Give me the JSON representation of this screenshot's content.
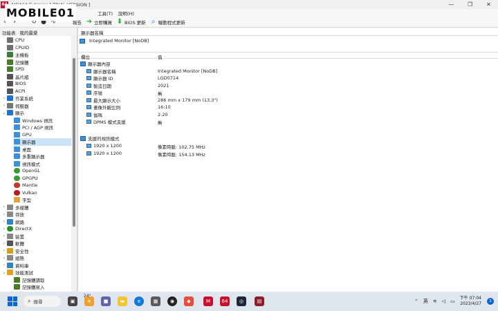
{
  "window": {
    "logo_text": "64",
    "title": "AIDA64 Extreme  [ TRIAL VERSION ]",
    "controls": [
      "—",
      "❐",
      "✕"
    ]
  },
  "watermark": {
    "text": "MOBILE01"
  },
  "menubar": {
    "items": [
      {
        "label": "工具(T)"
      },
      {
        "label": "說明(H)"
      }
    ]
  },
  "toolbar": {
    "report_label": "報告",
    "buy_label": "立即購買",
    "bios_label": "BIOS 更新",
    "driver_label": "驅動程式更新"
  },
  "sidebar": {
    "tabs": [
      "功能表",
      "我的最愛"
    ],
    "tree": [
      {
        "label": "CPU",
        "color": "#707070"
      },
      {
        "label": "CPUID",
        "color": "#707070"
      },
      {
        "label": "主機板",
        "color": "#3a7d3a"
      },
      {
        "label": "記憶體",
        "color": "#4a7a2a"
      },
      {
        "label": "SPD",
        "color": "#4a7a2a"
      },
      {
        "label": "晶片組",
        "color": "#555555"
      },
      {
        "label": "BIOS",
        "color": "#555555"
      },
      {
        "label": "ACPI",
        "color": "#555555"
      },
      {
        "label": "作業系統",
        "color": "#1e73d0"
      },
      {
        "label": "伺服器",
        "color": "#777777"
      },
      {
        "label": "顯示",
        "color": "#1e73d0"
      },
      {
        "label": "Windows 視訊",
        "color": "#3d8fd6"
      },
      {
        "label": "PCI / AGP 視訊",
        "color": "#3d8fd6"
      },
      {
        "label": "GPU",
        "color": "#3d8fd6"
      },
      {
        "label": "顯示器",
        "color": "#3d8fd6"
      },
      {
        "label": "桌面",
        "color": "#3d8fd6"
      },
      {
        "label": "多重顯示器",
        "color": "#3d8fd6"
      },
      {
        "label": "視訊模式",
        "color": "#3d8fd6"
      },
      {
        "label": "OpenGL",
        "color": "#3a9a3a"
      },
      {
        "label": "GPGPU",
        "color": "#3a9a3a"
      },
      {
        "label": "Mantle",
        "color": "#c0392b"
      },
      {
        "label": "Vulkan",
        "color": "#b71c1c"
      },
      {
        "label": "字型",
        "color": "#d9a441"
      },
      {
        "label": "多媒體",
        "color": "#888888"
      },
      {
        "label": "存放",
        "color": "#888888"
      },
      {
        "label": "網路",
        "color": "#2e86c1"
      },
      {
        "label": "DirectX",
        "color": "#2e8b2e"
      },
      {
        "label": "裝置",
        "color": "#888888"
      },
      {
        "label": "軟體",
        "color": "#555555"
      },
      {
        "label": "安全性",
        "color": "#d4a017"
      },
      {
        "label": "組態",
        "color": "#888888"
      },
      {
        "label": "資料庫",
        "color": "#2e86c1"
      },
      {
        "label": "效能測試",
        "color": "#e0a020"
      },
      {
        "label": "記憶體讀取",
        "color": "#4a7a2a"
      },
      {
        "label": "記憶體寫入",
        "color": "#4a7a2a"
      }
    ]
  },
  "content": {
    "header": "顯示器名稱",
    "device": "Integrated Monitor [NoDB]",
    "col_field": "欄位",
    "col_value": "值",
    "section1": "顯示器內容",
    "props": [
      {
        "name": "顯示器名稱",
        "value": "Integrated Monitor [NoDB]"
      },
      {
        "name": "顯示器 ID",
        "value": "LGD0714"
      },
      {
        "name": "製造日期",
        "value": "2021"
      },
      {
        "name": "序號",
        "value": "無"
      },
      {
        "name": "最大顯示大小",
        "value": "286 mm x 179 mm (13.3\")"
      },
      {
        "name": "畫像外觀比例",
        "value": "16:10"
      },
      {
        "name": "伽瑪",
        "value": "2.20"
      },
      {
        "name": "DPMS 模式支援",
        "value": "無"
      }
    ],
    "section2": "支援的視訊模式",
    "modes": [
      {
        "name": "1920 x 1200",
        "value": "像素時脈: 102.75 MHz"
      },
      {
        "name": "1920 x 1200",
        "value": "像素時脈: 154.13 MHz"
      }
    ]
  },
  "taskbar": {
    "search_label": "搜尋",
    "weather": "24°",
    "ime": "英",
    "time_line1": "下午 07:04",
    "time_line2": "2023/4/27",
    "notif_count": "2",
    "aida_label": "64"
  }
}
